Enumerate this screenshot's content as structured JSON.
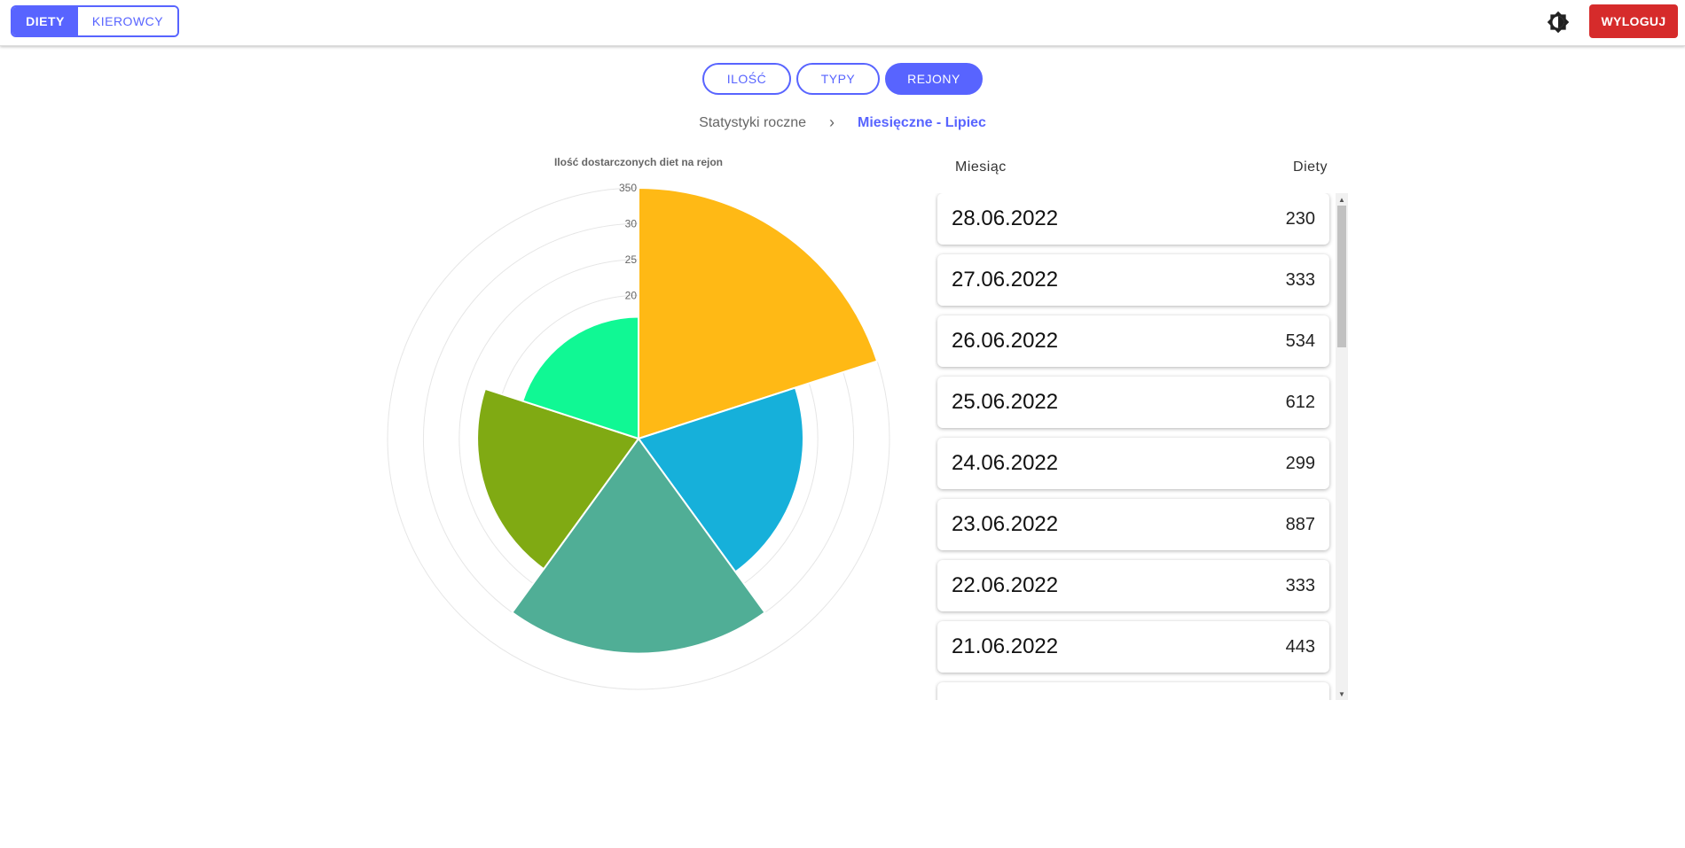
{
  "header": {
    "tabs": [
      {
        "label": "DIETY",
        "active": true
      },
      {
        "label": "KIEROWCY",
        "active": false
      }
    ],
    "theme_icon": "brightness-icon",
    "logout_label": "WYLOGUJ"
  },
  "filters": [
    {
      "label": "ILOŚĆ",
      "active": false
    },
    {
      "label": "TYPY",
      "active": false
    },
    {
      "label": "REJONY",
      "active": true
    }
  ],
  "breadcrumb": {
    "root": "Statystyki roczne",
    "current": "Miesięczne - Lipiec"
  },
  "table": {
    "col_month": "Miesiąc",
    "col_diets": "Diety",
    "rows": [
      {
        "date": "28.06.2022",
        "count": "230"
      },
      {
        "date": "27.06.2022",
        "count": "333"
      },
      {
        "date": "26.06.2022",
        "count": "534"
      },
      {
        "date": "25.06.2022",
        "count": "612"
      },
      {
        "date": "24.06.2022",
        "count": "299"
      },
      {
        "date": "23.06.2022",
        "count": "887"
      },
      {
        "date": "22.06.2022",
        "count": "333"
      },
      {
        "date": "21.06.2022",
        "count": "443"
      },
      {
        "date": "",
        "count": ""
      }
    ]
  },
  "colors": {
    "accent": "#5864ff",
    "logout": "#d62b2b"
  },
  "chart_data": {
    "type": "polarArea",
    "title": "Ilość dostarczonych diet na rejon",
    "rmax": 350,
    "ticks": [
      200,
      250,
      300,
      350
    ],
    "tick_labels": [
      "20",
      "25",
      "30",
      "350"
    ],
    "values": [
      350,
      230,
      300,
      225,
      170
    ],
    "colors": [
      "#ffb915",
      "#16b0da",
      "#50ae96",
      "#80aa13",
      "#10f894"
    ]
  }
}
